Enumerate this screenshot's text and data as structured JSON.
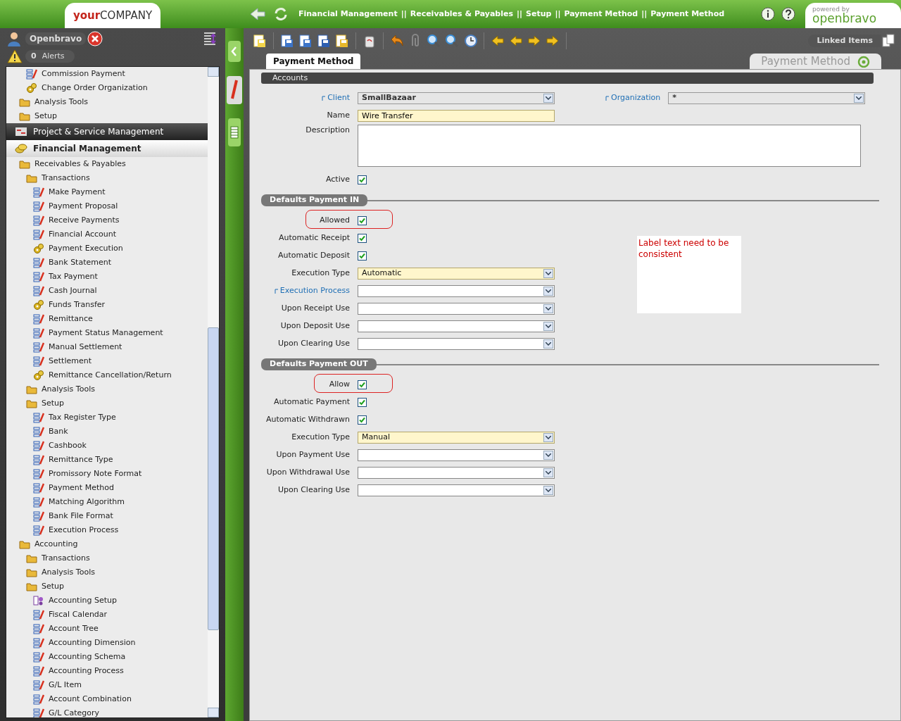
{
  "header": {
    "logo": {
      "part1": "your",
      "part2": "COMPANY"
    },
    "breadcrumb": {
      "separator": "||",
      "items": [
        "Financial Management",
        "Receivables & Payables",
        "Setup",
        "Payment Method",
        "Payment Method"
      ]
    },
    "powered_by": "powered by",
    "brand": "openbravo"
  },
  "user": {
    "name": "Openbravo",
    "alerts_count": "0",
    "alerts_label": "Alerts"
  },
  "sidebar": {
    "items": [
      {
        "children": [
          {
            "children": [
              {
                "kind": "window",
                "label": "Commission Payment"
              },
              {
                "kind": "process",
                "label": "Change Order Organization"
              }
            ]
          },
          {
            "kind": "folder",
            "label": "Analysis Tools"
          },
          {
            "kind": "folder",
            "label": "Setup"
          }
        ]
      },
      {
        "kind": "module",
        "label": "Project & Service Management",
        "selected": true
      },
      {
        "kind": "module",
        "label": "Financial Management",
        "selected": false,
        "children": [
          {
            "kind": "folder",
            "label": "Receivables & Payables",
            "children": [
              {
                "kind": "folder",
                "label": "Transactions",
                "children": [
                  {
                    "kind": "window",
                    "label": "Make Payment"
                  },
                  {
                    "kind": "window",
                    "label": "Payment Proposal"
                  },
                  {
                    "kind": "window",
                    "label": "Receive Payments"
                  },
                  {
                    "kind": "window",
                    "label": "Financial Account"
                  },
                  {
                    "kind": "process",
                    "label": "Payment Execution"
                  },
                  {
                    "kind": "window",
                    "label": "Bank Statement"
                  },
                  {
                    "kind": "window",
                    "label": "Tax Payment"
                  },
                  {
                    "kind": "window",
                    "label": "Cash Journal"
                  },
                  {
                    "kind": "process",
                    "label": "Funds Transfer"
                  },
                  {
                    "kind": "window",
                    "label": "Remittance"
                  },
                  {
                    "kind": "window",
                    "label": "Payment Status Management"
                  },
                  {
                    "kind": "window",
                    "label": "Manual Settlement"
                  },
                  {
                    "kind": "window",
                    "label": "Settlement"
                  },
                  {
                    "kind": "process",
                    "label": "Remittance Cancellation/Return"
                  }
                ]
              },
              {
                "kind": "folder",
                "label": "Analysis Tools"
              },
              {
                "kind": "folder",
                "label": "Setup",
                "children": [
                  {
                    "kind": "window",
                    "label": "Tax Register Type"
                  },
                  {
                    "kind": "window",
                    "label": "Bank"
                  },
                  {
                    "kind": "window",
                    "label": "Cashbook"
                  },
                  {
                    "kind": "window",
                    "label": "Remittance Type"
                  },
                  {
                    "kind": "window",
                    "label": "Promissory Note Format"
                  },
                  {
                    "kind": "window",
                    "label": "Payment Method"
                  },
                  {
                    "kind": "window",
                    "label": "Matching Algorithm"
                  },
                  {
                    "kind": "window",
                    "label": "Bank File Format"
                  },
                  {
                    "kind": "window",
                    "label": "Execution Process"
                  }
                ]
              }
            ]
          },
          {
            "kind": "folder",
            "label": "Accounting",
            "children": [
              {
                "kind": "folder",
                "label": "Transactions"
              },
              {
                "kind": "folder",
                "label": "Analysis Tools"
              },
              {
                "kind": "folder",
                "label": "Setup",
                "children": [
                  {
                    "kind": "wizard",
                    "label": "Accounting Setup"
                  },
                  {
                    "kind": "window",
                    "label": "Fiscal Calendar"
                  },
                  {
                    "kind": "window",
                    "label": "Account Tree"
                  },
                  {
                    "kind": "window",
                    "label": "Accounting Dimension"
                  },
                  {
                    "kind": "window",
                    "label": "Accounting Schema"
                  },
                  {
                    "kind": "window",
                    "label": "Accounting Process"
                  },
                  {
                    "kind": "window",
                    "label": "G/L Item"
                  },
                  {
                    "kind": "window",
                    "label": "Account Combination"
                  },
                  {
                    "kind": "window",
                    "label": "G/L Category"
                  }
                ]
              }
            ]
          }
        ]
      }
    ]
  },
  "toolbar": {
    "linked_items": "Linked Items"
  },
  "tabs": [
    {
      "label": "Payment Method",
      "selected": true
    }
  ],
  "window_title": "Payment Method",
  "form": {
    "sections": [
      {
        "title": "Accounts",
        "kind": "bar",
        "rows": [
          {
            "kind": "select",
            "label": "Client",
            "link": true,
            "required": false,
            "readonly": true,
            "value": "SmallBazaar",
            "right": {
              "kind": "select",
              "label": "Organization",
              "link": true,
              "required": false,
              "readonly": true,
              "value": "*"
            }
          },
          {
            "kind": "text",
            "label": "Name",
            "link": false,
            "required": true,
            "value": "Wire Transfer"
          },
          {
            "kind": "textarea",
            "label": "Description",
            "link": false,
            "required": false
          },
          {
            "kind": "checkbox",
            "label": "Active",
            "link": false,
            "checked": true
          }
        ]
      },
      {
        "title": "Defaults Payment IN",
        "kind": "group",
        "rows": [
          {
            "kind": "checkbox",
            "label": "Allowed",
            "link": false,
            "checked": true,
            "highlighted": true
          },
          {
            "kind": "checkbox",
            "label": "Automatic Receipt",
            "link": false,
            "checked": true
          },
          {
            "kind": "checkbox",
            "label": "Automatic Deposit",
            "link": false,
            "checked": true
          },
          {
            "kind": "select",
            "label": "Execution Type",
            "link": false,
            "required": true,
            "value": "Automatic"
          },
          {
            "kind": "select",
            "label": "Execution Process",
            "link": true,
            "required": false
          },
          {
            "kind": "select",
            "label": "Upon Receipt Use",
            "link": false,
            "required": false
          },
          {
            "kind": "select",
            "label": "Upon Deposit Use",
            "link": false,
            "required": false
          },
          {
            "kind": "select",
            "label": "Upon Clearing Use",
            "link": false,
            "required": false
          }
        ]
      },
      {
        "title": "Defaults Payment OUT",
        "kind": "group",
        "rows": [
          {
            "kind": "checkbox",
            "label": "Allow",
            "link": false,
            "checked": true,
            "highlighted": true
          },
          {
            "kind": "checkbox",
            "label": "Automatic Payment",
            "link": false,
            "checked": true
          },
          {
            "kind": "checkbox",
            "label": "Automatic Withdrawn",
            "link": false,
            "checked": true
          },
          {
            "kind": "select",
            "label": "Execution Type",
            "link": false,
            "required": true,
            "value": "Manual"
          },
          {
            "kind": "select",
            "label": "Upon Payment Use",
            "link": false,
            "required": false
          },
          {
            "kind": "select",
            "label": "Upon Withdrawal Use",
            "link": false,
            "required": false
          },
          {
            "kind": "select",
            "label": "Upon Clearing Use",
            "link": false,
            "required": false
          }
        ]
      }
    ]
  },
  "annotation": {
    "text": "Label text need to be consistent"
  }
}
